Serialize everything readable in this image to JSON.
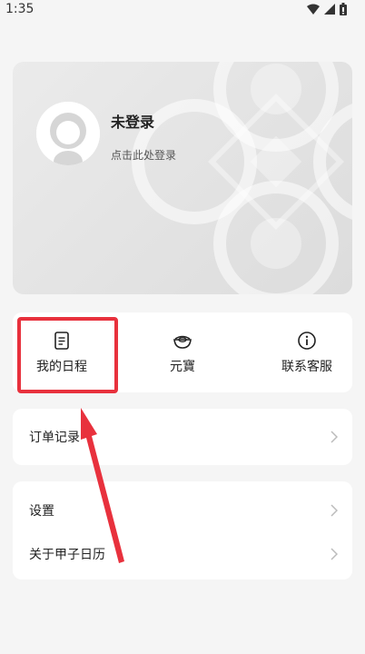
{
  "status_bar": {
    "time": "1:35",
    "icons": [
      "wifi-icon",
      "signal-icon",
      "battery-icon"
    ]
  },
  "profile": {
    "title": "未登录",
    "subtitle": "点击此处登录"
  },
  "quick_actions": [
    {
      "label": "我的日程",
      "icon": "schedule-icon"
    },
    {
      "label": "元寶",
      "icon": "ingot-icon"
    },
    {
      "label": "联系客服",
      "icon": "info-icon"
    }
  ],
  "menu_group_1": [
    {
      "label": "订单记录"
    }
  ],
  "menu_group_2": [
    {
      "label": "设置"
    },
    {
      "label": "关于甲子日历"
    }
  ],
  "colors": {
    "highlight": "#e8313d",
    "background": "#f5f5f5",
    "card": "#ffffff"
  }
}
